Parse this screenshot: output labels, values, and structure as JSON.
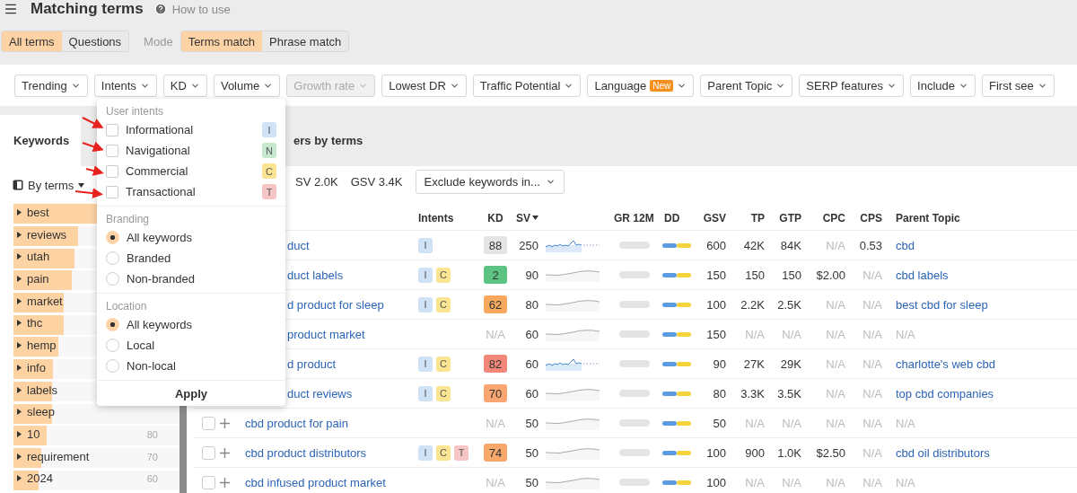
{
  "header": {
    "title": "Matching terms",
    "help": "How to use"
  },
  "scope_tabs": [
    {
      "label": "All terms",
      "selected": true
    },
    {
      "label": "Questions",
      "selected": false
    }
  ],
  "mode": {
    "label": "Mode",
    "options": [
      {
        "label": "Terms match",
        "selected": true
      },
      {
        "label": "Phrase match",
        "selected": false
      }
    ]
  },
  "filters": [
    {
      "label": "Trending",
      "disabled": false
    },
    {
      "label": "Intents",
      "disabled": false
    },
    {
      "label": "KD",
      "disabled": false
    },
    {
      "label": "Volume",
      "disabled": false
    },
    {
      "label": "Growth rate",
      "disabled": true
    },
    {
      "label": "Lowest DR",
      "disabled": false
    },
    {
      "label": "Traffic Potential",
      "disabled": false
    },
    {
      "label": "Language",
      "disabled": false,
      "badge": "New"
    },
    {
      "label": "Parent Topic",
      "disabled": false
    },
    {
      "label": "SERP features",
      "disabled": false
    },
    {
      "label": "Include",
      "disabled": false
    },
    {
      "label": "First see",
      "disabled": false
    }
  ],
  "tabs": [
    {
      "label": "Keywords",
      "selected": true
    },
    {
      "label": "ers by terms",
      "selected": false
    }
  ],
  "group_by": "By terms",
  "terms": [
    {
      "label": "best",
      "level": 0.62
    },
    {
      "label": "reviews",
      "level": 0.39
    },
    {
      "label": "utah",
      "level": 0.37
    },
    {
      "label": "pain",
      "level": 0.35
    },
    {
      "label": "market",
      "level": 0.3
    },
    {
      "label": "thc",
      "level": 0.3
    },
    {
      "label": "hemp",
      "level": 0.27
    },
    {
      "label": "info",
      "level": 0.24
    },
    {
      "label": "labels",
      "level": 0.23
    },
    {
      "label": "sleep",
      "level": 0.23
    },
    {
      "label": "10",
      "level": 0.2,
      "count": "80"
    },
    {
      "label": "requirement",
      "level": 0.17,
      "count": "70"
    },
    {
      "label": "2024",
      "level": 0.15,
      "count": "60"
    }
  ],
  "stats": [
    "SV 2.0K",
    "GSV 3.4K"
  ],
  "exclude": "Exclude keywords in...",
  "table": {
    "columns": [
      {
        "label": "Intents",
        "sorted": false
      },
      {
        "label": "KD",
        "sorted": false
      },
      {
        "label": "SV",
        "sorted": true
      },
      {
        "label": "GR 12M",
        "sorted": false
      },
      {
        "label": "DD",
        "sorted": false
      },
      {
        "label": "GSV",
        "sorted": false
      },
      {
        "label": "TP",
        "sorted": false
      },
      {
        "label": "GTP",
        "sorted": false
      },
      {
        "label": "CPC",
        "sorted": false
      },
      {
        "label": "CPS",
        "sorted": false
      },
      {
        "label": "Parent Topic",
        "sorted": false
      }
    ],
    "rows": [
      {
        "keyword": "duct",
        "clipped": true,
        "intents": [
          {
            "letter": "I",
            "color": "#cfe2f6"
          }
        ],
        "kd": {
          "text": "88",
          "color": "#e4e4e4"
        },
        "sv": "250",
        "trend": {
          "kind": "active"
        },
        "gsv": "600",
        "tp": {
          "text": "42K",
          "muted": false
        },
        "gtp": {
          "text": "84K",
          "muted": false
        },
        "cpc": {
          "text": "N/A",
          "muted": true
        },
        "cps": {
          "text": "0.53",
          "muted": false
        },
        "parent": {
          "text": "cbd",
          "muted": false
        }
      },
      {
        "keyword": "duct labels",
        "clipped": true,
        "intents": [
          {
            "letter": "I",
            "color": "#cfe2f6"
          },
          {
            "letter": "C",
            "color": "#fbe592"
          }
        ],
        "kd": {
          "text": "2",
          "color": "#5cc383"
        },
        "sv": "90",
        "trend": {
          "kind": "flat"
        },
        "gsv": "150",
        "tp": {
          "text": "150",
          "muted": false
        },
        "gtp": {
          "text": "150",
          "muted": false
        },
        "cpc": {
          "text": "$2.00",
          "muted": false
        },
        "cps": {
          "text": "N/A",
          "muted": true
        },
        "parent": {
          "text": "cbd labels",
          "muted": false
        }
      },
      {
        "keyword": "d product for sleep",
        "clipped": true,
        "intents": [
          {
            "letter": "I",
            "color": "#cfe2f6"
          },
          {
            "letter": "C",
            "color": "#fbe592"
          }
        ],
        "kd": {
          "text": "62",
          "color": "#f8a95f"
        },
        "sv": "80",
        "trend": {
          "kind": "flat"
        },
        "gsv": "100",
        "tp": {
          "text": "2.2K",
          "muted": false
        },
        "gtp": {
          "text": "2.5K",
          "muted": false
        },
        "cpc": {
          "text": "N/A",
          "muted": true
        },
        "cps": {
          "text": "N/A",
          "muted": true
        },
        "parent": {
          "text": "best cbd for sleep",
          "muted": false
        }
      },
      {
        "keyword": "product market",
        "clipped": true,
        "intents": [],
        "kd": {
          "text": "N/A"
        },
        "sv": "60",
        "trend": {
          "kind": "flat"
        },
        "gsv": "150",
        "tp": {
          "text": "N/A",
          "muted": true
        },
        "gtp": {
          "text": "N/A",
          "muted": true
        },
        "cpc": {
          "text": "N/A",
          "muted": true
        },
        "cps": {
          "text": "N/A",
          "muted": true
        },
        "parent": {
          "text": "N/A",
          "muted": true
        }
      },
      {
        "keyword": "d product",
        "clipped": true,
        "intents": [
          {
            "letter": "I",
            "color": "#cfe2f6"
          },
          {
            "letter": "C",
            "color": "#fbe592"
          }
        ],
        "kd": {
          "text": "82",
          "color": "#f2877a"
        },
        "sv": "60",
        "trend": {
          "kind": "active"
        },
        "gsv": "90",
        "tp": {
          "text": "27K",
          "muted": false
        },
        "gtp": {
          "text": "29K",
          "muted": false
        },
        "cpc": {
          "text": "N/A",
          "muted": true
        },
        "cps": {
          "text": "N/A",
          "muted": true
        },
        "parent": {
          "text": "charlotte's web cbd",
          "muted": false
        }
      },
      {
        "keyword": "duct reviews",
        "clipped": true,
        "intents": [
          {
            "letter": "I",
            "color": "#cfe2f6"
          },
          {
            "letter": "C",
            "color": "#fbe592"
          }
        ],
        "kd": {
          "text": "70",
          "color": "#f9a671"
        },
        "sv": "60",
        "trend": {
          "kind": "flat"
        },
        "gsv": "80",
        "tp": {
          "text": "3.3K",
          "muted": false
        },
        "gtp": {
          "text": "3.5K",
          "muted": false
        },
        "cpc": {
          "text": "N/A",
          "muted": true
        },
        "cps": {
          "text": "N/A",
          "muted": true
        },
        "parent": {
          "text": "top cbd companies",
          "muted": false
        }
      },
      {
        "keyword": "cbd product for pain",
        "clipped": false,
        "checked": false,
        "intents": [],
        "kd": {
          "text": "N/A"
        },
        "sv": "50",
        "trend": {
          "kind": "flat"
        },
        "gsv": "50",
        "tp": {
          "text": "N/A",
          "muted": true
        },
        "gtp": {
          "text": "N/A",
          "muted": true
        },
        "cpc": {
          "text": "N/A",
          "muted": true
        },
        "cps": {
          "text": "N/A",
          "muted": true
        },
        "parent": {
          "text": "N/A",
          "muted": true
        }
      },
      {
        "keyword": "cbd product distributors",
        "clipped": false,
        "checked": false,
        "intents": [
          {
            "letter": "I",
            "color": "#cfe2f6"
          },
          {
            "letter": "C",
            "color": "#fbe592"
          },
          {
            "letter": "T",
            "color": "#f6c6c6"
          }
        ],
        "kd": {
          "text": "74",
          "color": "#f8a86a"
        },
        "sv": "50",
        "trend": {
          "kind": "flat"
        },
        "gsv": "100",
        "tp": {
          "text": "900",
          "muted": false
        },
        "gtp": {
          "text": "1.0K",
          "muted": false
        },
        "cpc": {
          "text": "$2.50",
          "muted": false
        },
        "cps": {
          "text": "N/A",
          "muted": true
        },
        "parent": {
          "text": "cbd oil distributors",
          "muted": false
        }
      },
      {
        "keyword": "cbd infused product market",
        "clipped": false,
        "checked": false,
        "intents": [],
        "kd": {
          "text": "N/A"
        },
        "sv": "50",
        "trend": {
          "kind": "flat"
        },
        "gsv": "100",
        "tp": {
          "text": "N/A",
          "muted": true
        },
        "gtp": {
          "text": "N/A",
          "muted": true
        },
        "cpc": {
          "text": "N/A",
          "muted": true
        },
        "cps": {
          "text": "N/A",
          "muted": true
        },
        "parent": {
          "text": "N/A",
          "muted": true
        }
      }
    ]
  },
  "intents_menu": {
    "sections": [
      {
        "title": "User intents",
        "kind": "checkbox",
        "items": [
          {
            "label": "Informational",
            "checked": false,
            "badge": "I",
            "color": "#cfe2f6"
          },
          {
            "label": "Navigational",
            "checked": false,
            "badge": "N",
            "color": "#c6e8cf"
          },
          {
            "label": "Commercial",
            "checked": false,
            "badge": "C",
            "color": "#fbe592"
          },
          {
            "label": "Transactional",
            "checked": false,
            "badge": "T",
            "color": "#f6c6c6"
          }
        ]
      },
      {
        "title": "Branding",
        "kind": "radio",
        "items": [
          {
            "label": "All keywords",
            "selected": true
          },
          {
            "label": "Branded",
            "selected": false
          },
          {
            "label": "Non-branded",
            "selected": false
          }
        ]
      },
      {
        "title": "Location",
        "kind": "radio",
        "items": [
          {
            "label": "All keywords",
            "selected": true
          },
          {
            "label": "Local",
            "selected": false
          },
          {
            "label": "Non-local",
            "selected": false
          }
        ]
      }
    ],
    "apply": "Apply"
  }
}
